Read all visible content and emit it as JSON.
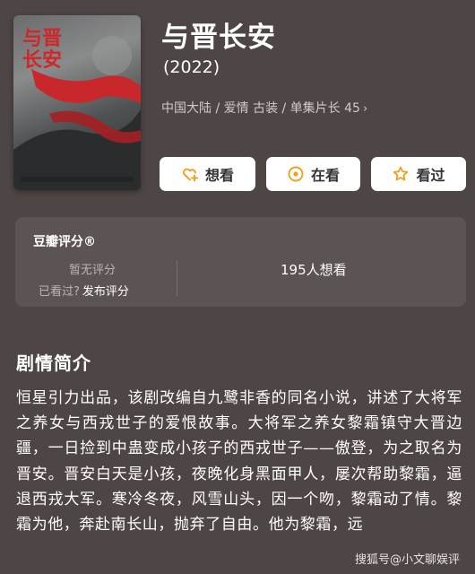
{
  "movie": {
    "title": "与晋长安",
    "year": "(2022)",
    "meta": "中国大陆 / 爱情 古装 / 单集片长 45",
    "meta_chevron": "›",
    "poster_title": "与晋长安"
  },
  "actions": {
    "want_label": "想看",
    "watching_label": "在看",
    "watched_label": "看过"
  },
  "rating": {
    "title": "豆瓣评分®",
    "no_rating": "暂无评分",
    "watched_prompt": "已看过?",
    "post_link": "发布评分",
    "want_count": "195人想看"
  },
  "synopsis": {
    "heading": "剧情简介",
    "text": "恒星引力出品，该剧改编自九鹭非香的同名小说，讲述了大将军之养女与西戎世子的爱恨故事。大将军之养女黎霜镇守大晋边疆，一日捡到中蛊变成小孩子的西戎世子——傲登，为之取名为晋安。晋安白天是小孩，夜晚化身黑面甲人，屡次帮助黎霜，逼退西戎大军。寒冷冬夜，风雪山头，因一个吻，黎霜动了情。黎霜为他，奔赴南长山，抛弃了自由。他为黎霜，远"
  },
  "watermark": "搜狐号@小文聊娱评",
  "colors": {
    "background": "#4e4645",
    "card": "#5b5453",
    "accent_orange": "#f0a020",
    "poster_red": "#d1262a"
  },
  "icons": {
    "want": "heart-plus-icon",
    "watching": "circle-dot-icon",
    "watched": "star-icon"
  }
}
